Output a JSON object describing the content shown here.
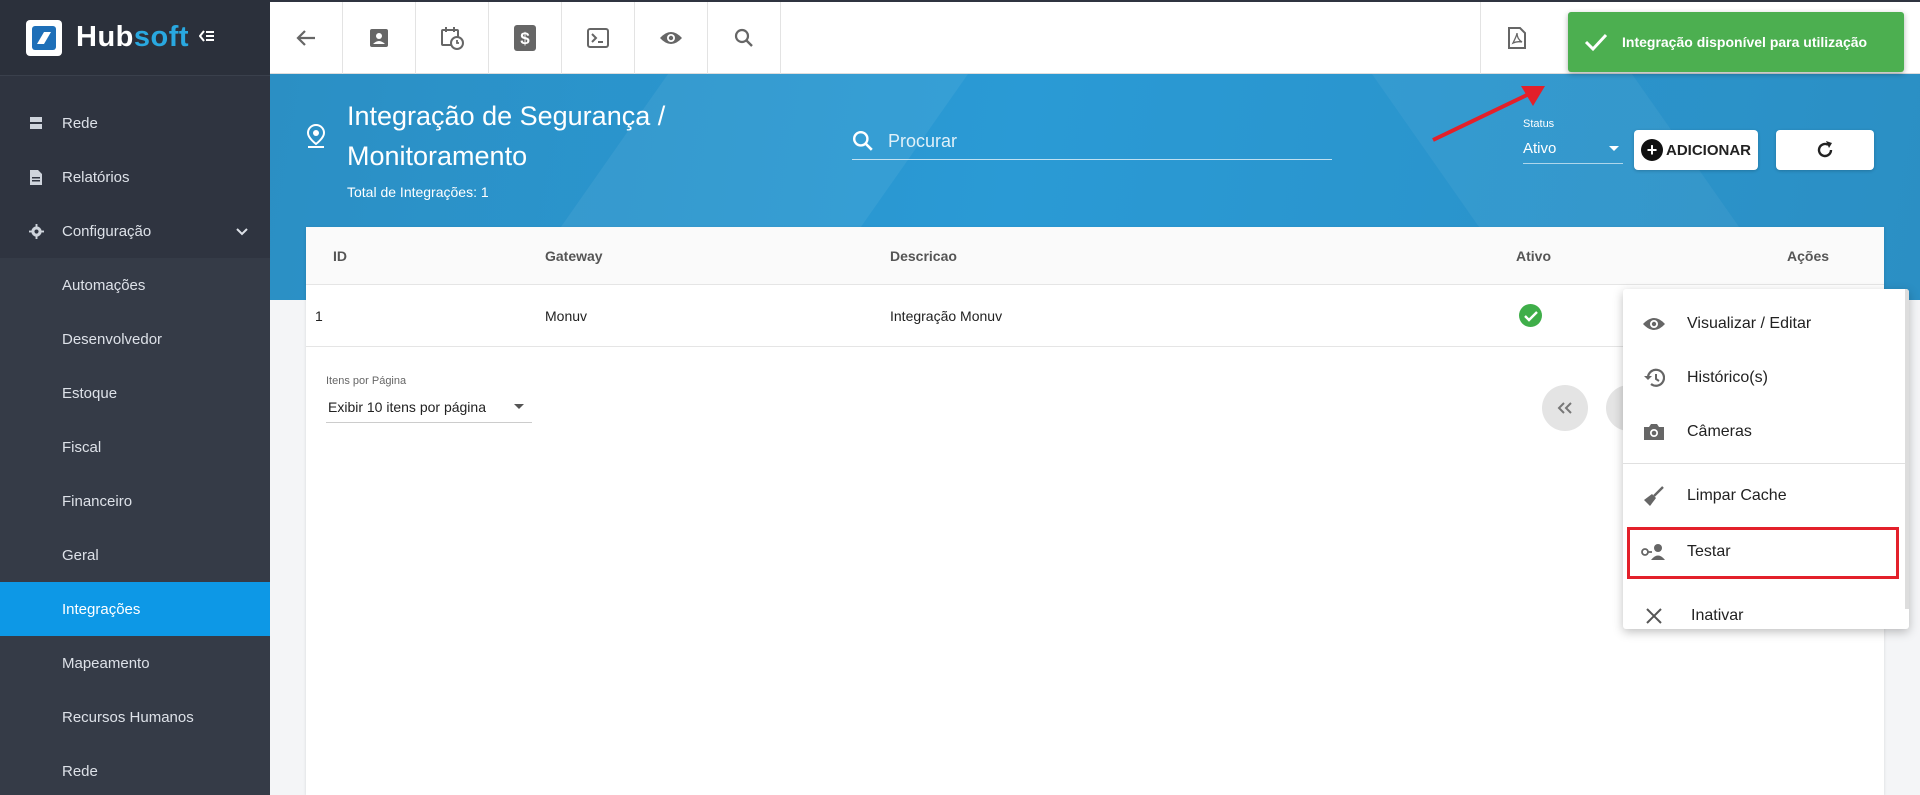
{
  "app": {
    "logo_text_left": "Hub",
    "logo_text_right": "soft",
    "collapse_icon": "menu-collapse-icon"
  },
  "sidebar": {
    "items": [
      {
        "label": "Rede",
        "icon": "server-icon",
        "type": "group"
      },
      {
        "label": "Relatórios",
        "icon": "report-icon",
        "type": "group"
      },
      {
        "label": "Configuração",
        "icon": "gear-icon",
        "type": "group",
        "expanded": true
      },
      {
        "label": "Automações",
        "type": "sub"
      },
      {
        "label": "Desenvolvedor",
        "type": "sub"
      },
      {
        "label": "Estoque",
        "type": "sub"
      },
      {
        "label": "Fiscal",
        "type": "sub"
      },
      {
        "label": "Financeiro",
        "type": "sub"
      },
      {
        "label": "Geral",
        "type": "sub"
      },
      {
        "label": "Integrações",
        "type": "sub",
        "active": true
      },
      {
        "label": "Mapeamento",
        "type": "sub"
      },
      {
        "label": "Recursos Humanos",
        "type": "sub"
      },
      {
        "label": "Rede",
        "type": "sub"
      }
    ]
  },
  "toolbar": {
    "buttons": [
      "back-arrow-icon",
      "contact-card-icon",
      "calendar-clock-icon",
      "dollar-icon",
      "terminal-icon",
      "eye-icon",
      "search-icon"
    ],
    "right_buttons": [
      "pdf-icon"
    ]
  },
  "header": {
    "title": "Integração de Segurança / Monitoramento",
    "total": "Total de Integrações: 1",
    "search_placeholder": "Procurar",
    "status_label": "Status",
    "status_value": "Ativo",
    "add_label": "ADICIONAR"
  },
  "table": {
    "columns": [
      "ID",
      "Gateway",
      "Descricao",
      "Ativo",
      "Ações"
    ],
    "rows": [
      {
        "id": "1",
        "gateway": "Monuv",
        "descricao": "Integração Monuv",
        "ativo": true
      }
    ],
    "per_page_label": "Itens por Página",
    "per_page_value": "Exibir 10 itens por página"
  },
  "toast": {
    "message": "Integração disponível para utilização"
  },
  "menu": {
    "items": [
      {
        "label": "Visualizar / Editar",
        "icon": "eye-icon"
      },
      {
        "label": "Histórico(s)",
        "icon": "history-icon"
      },
      {
        "label": "Câmeras",
        "icon": "camera-icon"
      },
      {
        "label": "Limpar Cache",
        "icon": "broom-icon"
      },
      {
        "label": "Testar",
        "icon": "user-key-icon",
        "highlighted": true
      },
      {
        "label": "Inativar",
        "icon": "close-icon"
      }
    ]
  },
  "colors": {
    "sidebar": "#2f3440",
    "active": "#0d98e6",
    "header": "#2a9ad5",
    "toast": "#4caf50",
    "highlight": "#e3202a"
  }
}
